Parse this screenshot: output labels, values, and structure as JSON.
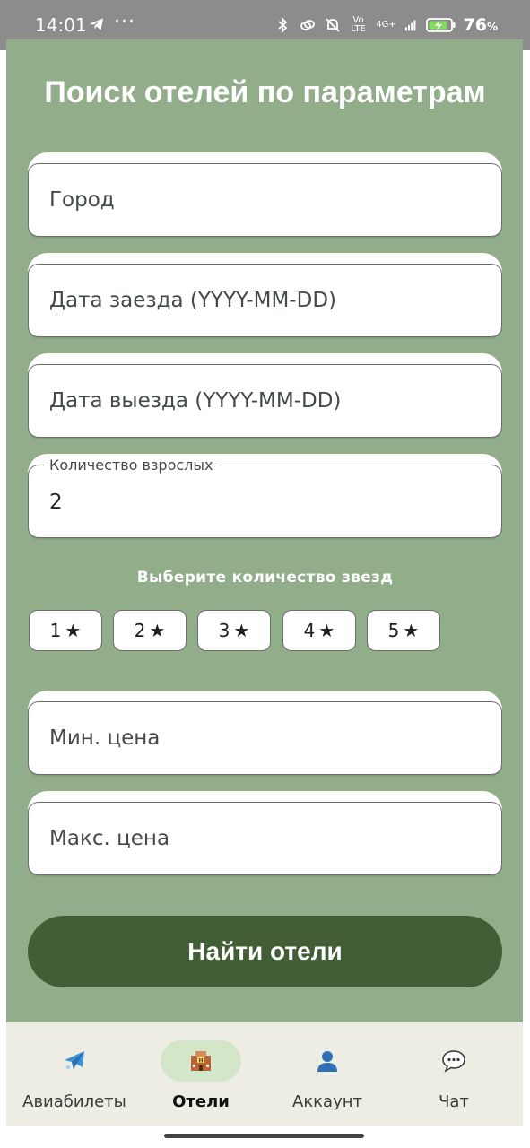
{
  "status_bar": {
    "time": "14:01",
    "dots": "···",
    "battery_percent": "76",
    "battery_suffix": "%",
    "network": "4G+",
    "volte": "Vo LTE"
  },
  "header": {
    "title": "Поиск отелей по параметрам"
  },
  "form": {
    "city_placeholder": "Город",
    "checkin_placeholder": "Дата заезда (YYYY-MM-DD)",
    "checkout_placeholder": "Дата выезда (YYYY-MM-DD)",
    "adults_label": "Количество взрослых",
    "adults_value": "2",
    "stars_label": "Выберите количество звезд",
    "stars": [
      {
        "num": "1",
        "glyph": "★"
      },
      {
        "num": "2",
        "glyph": "★"
      },
      {
        "num": "3",
        "glyph": "★"
      },
      {
        "num": "4",
        "glyph": "★"
      },
      {
        "num": "5",
        "glyph": "★"
      }
    ],
    "min_price_placeholder": "Мин. цена",
    "max_price_placeholder": "Макс. цена",
    "submit_label": "Найти отели"
  },
  "bottom_nav": {
    "items": [
      {
        "label": "Авиабилеты",
        "icon": "airplane-icon",
        "active": false
      },
      {
        "label": "Отели",
        "icon": "hotel-icon",
        "active": true
      },
      {
        "label": "Аккаунт",
        "icon": "user-icon",
        "active": false
      },
      {
        "label": "Чат",
        "icon": "chat-icon",
        "active": false
      }
    ]
  },
  "colors": {
    "background": "#92ad8a",
    "button": "#425e36",
    "nav_background": "#edede4",
    "nav_active_pill": "#d3e6c9"
  }
}
